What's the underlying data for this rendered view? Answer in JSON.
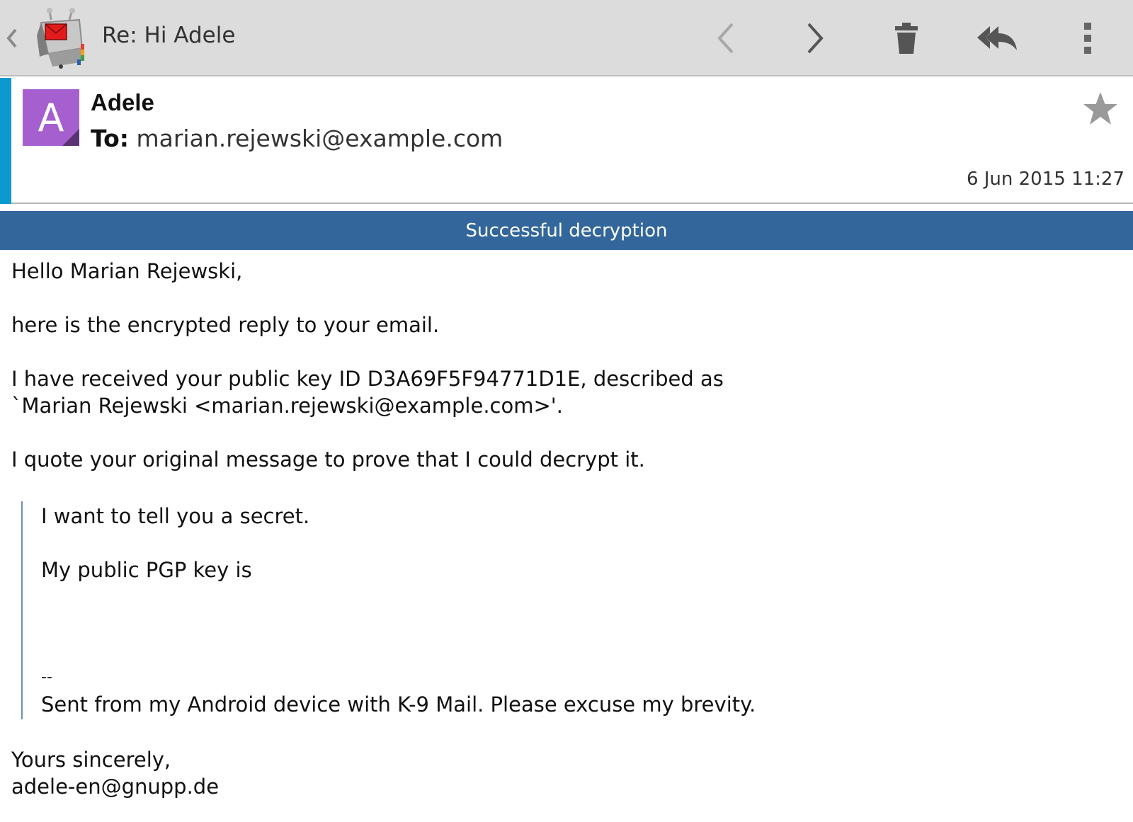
{
  "actionbar": {
    "title": "Re: Hi Adele",
    "icons": [
      "up-caret-icon",
      "app-logo",
      "previous-icon",
      "next-icon",
      "delete-icon",
      "reply-all-icon",
      "overflow-menu-icon"
    ]
  },
  "header": {
    "avatar_letter": "A",
    "sender": "Adele",
    "to_label": "To:",
    "recipient": "marian.rejewski@example.com",
    "timestamp": "6 Jun 2015 11:27",
    "starred": false
  },
  "crypto_status": "Successful decryption",
  "body": {
    "greeting": "Hello Marian Rejewski,",
    "line1": "here is the encrypted reply to your email.",
    "line2a": "I have received your public key ID D3A69F5F94771D1E, described as",
    "line2b": "`Marian Rejewski <marian.rejewski@example.com>'.",
    "line3": "I quote your original message to prove that I could decrypt it.",
    "quote": {
      "q1": "I want to tell you a secret.",
      "q2": "My public PGP key is",
      "sig_sep": "--",
      "sig": "Sent from my Android device with K-9 Mail. Please excuse my brevity."
    },
    "closing": "Yours sincerely,",
    "signature": "adele-en@gnupp.de"
  },
  "colors": {
    "actionbar": "#dcdcdc",
    "account_strip": "#0a9ad0",
    "avatar": "#a55fcf",
    "banner": "#33679b",
    "quote_bar": "#6e8fb8"
  }
}
